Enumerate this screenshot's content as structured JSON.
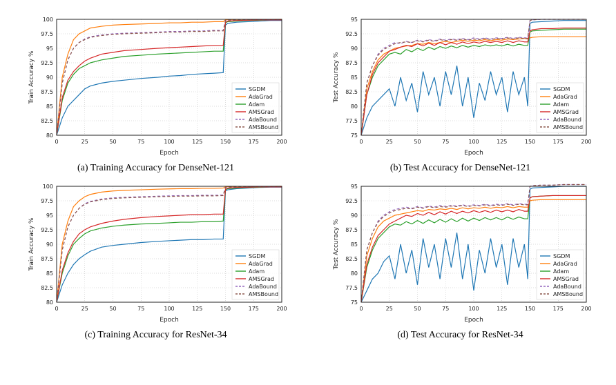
{
  "colors": {
    "SGDM": "#1f77b4",
    "AdaGrad": "#ff7f0e",
    "Adam": "#2ca02c",
    "AMSGrad": "#d62728",
    "AdaBound": "#9467bd",
    "AMSBound": "#8c564b"
  },
  "dashed": [
    "AdaBound",
    "AMSBound"
  ],
  "legend_order": [
    "SGDM",
    "AdaGrad",
    "Adam",
    "AMSGrad",
    "AdaBound",
    "AMSBound"
  ],
  "chart_data": [
    {
      "id": "a",
      "type": "line",
      "caption": "(a) Training Accuracy for DenseNet-121",
      "xlabel": "Epoch",
      "ylabel": "Train Accuracy %",
      "xlim": [
        0,
        200
      ],
      "ylim": [
        80.0,
        100.0
      ],
      "xticks": [
        0,
        25,
        50,
        75,
        100,
        125,
        150,
        175,
        200
      ],
      "yticks": [
        80.0,
        82.5,
        85.0,
        87.5,
        90.0,
        92.5,
        95.0,
        97.5,
        100.0
      ],
      "legend_pos": "lower-right",
      "x": [
        0,
        5,
        10,
        15,
        20,
        25,
        30,
        40,
        50,
        60,
        75,
        90,
        100,
        110,
        120,
        130,
        140,
        148,
        150,
        152,
        160,
        170,
        180,
        190,
        200
      ],
      "series": [
        {
          "name": "SGDM",
          "values": [
            80,
            83,
            85,
            86,
            87,
            88,
            88.5,
            89,
            89.3,
            89.5,
            89.8,
            90,
            90.2,
            90.3,
            90.5,
            90.6,
            90.7,
            90.8,
            99.0,
            99.3,
            99.5,
            99.6,
            99.7,
            99.8,
            99.8
          ]
        },
        {
          "name": "AdaGrad",
          "values": [
            80,
            90,
            94,
            96.5,
            97.5,
            98,
            98.5,
            98.8,
            99,
            99.1,
            99.2,
            99.3,
            99.4,
            99.4,
            99.5,
            99.5,
            99.6,
            99.6,
            99.9,
            99.95,
            99.97,
            99.98,
            99.99,
            99.99,
            100
          ]
        },
        {
          "name": "Adam",
          "values": [
            80,
            86,
            89,
            90.5,
            91.5,
            92,
            92.5,
            93,
            93.3,
            93.6,
            93.8,
            94,
            94.1,
            94.2,
            94.3,
            94.4,
            94.5,
            94.5,
            99.4,
            99.6,
            99.7,
            99.8,
            99.85,
            99.9,
            99.9
          ]
        },
        {
          "name": "AMSGrad",
          "values": [
            80,
            86.5,
            89.5,
            91,
            92,
            92.8,
            93.3,
            94,
            94.3,
            94.6,
            94.8,
            95,
            95.1,
            95.2,
            95.3,
            95.4,
            95.5,
            95.5,
            99.5,
            99.7,
            99.8,
            99.85,
            99.9,
            99.9,
            99.9
          ]
        },
        {
          "name": "AdaBound",
          "values": [
            80,
            89,
            93,
            95,
            96,
            96.6,
            97,
            97.3,
            97.5,
            97.6,
            97.7,
            97.8,
            97.9,
            97.9,
            98,
            98,
            98.1,
            98.1,
            99.8,
            99.9,
            99.93,
            99.95,
            99.97,
            99.98,
            99.98
          ]
        },
        {
          "name": "AMSBound",
          "values": [
            80,
            89,
            93,
            95,
            96,
            96.5,
            96.9,
            97.2,
            97.4,
            97.5,
            97.6,
            97.7,
            97.8,
            97.8,
            97.9,
            97.9,
            98,
            98,
            99.8,
            99.88,
            99.92,
            99.95,
            99.96,
            99.98,
            99.98
          ]
        }
      ]
    },
    {
      "id": "b",
      "type": "line",
      "caption": "(b) Test Accuracy for DenseNet-121",
      "xlabel": "Epoch",
      "ylabel": "Test Accuracy %",
      "xlim": [
        0,
        200
      ],
      "ylim": [
        75.0,
        95.0
      ],
      "xticks": [
        0,
        25,
        50,
        75,
        100,
        125,
        150,
        175,
        200
      ],
      "yticks": [
        75.0,
        77.5,
        80.0,
        82.5,
        85.0,
        87.5,
        90.0,
        92.5,
        95.0
      ],
      "legend_pos": "lower-right",
      "x": [
        0,
        5,
        10,
        15,
        20,
        25,
        30,
        35,
        40,
        45,
        50,
        55,
        60,
        65,
        70,
        75,
        80,
        85,
        90,
        95,
        100,
        105,
        110,
        115,
        120,
        125,
        130,
        135,
        140,
        145,
        148,
        150,
        152,
        160,
        170,
        180,
        190,
        200
      ],
      "series": [
        {
          "name": "SGDM",
          "values": [
            75,
            78,
            80,
            81,
            82,
            83,
            80,
            85,
            81,
            84,
            79,
            86,
            82,
            85,
            80,
            86,
            82,
            87,
            80,
            85,
            78,
            84,
            81,
            86,
            82,
            85,
            79,
            86,
            82,
            85,
            80,
            94.3,
            94.5,
            94.6,
            94.7,
            94.8,
            94.8,
            94.8
          ]
        },
        {
          "name": "AdaGrad",
          "values": [
            75,
            83,
            86,
            88,
            89,
            89.5,
            90,
            90.2,
            90.4,
            90.5,
            90.8,
            90.7,
            91,
            90.8,
            91,
            91.2,
            91,
            91.2,
            91.4,
            91.2,
            91.4,
            91.3,
            91.5,
            91.3,
            91.5,
            91.4,
            91.6,
            91.5,
            91.6,
            91.7,
            91.6,
            91.8,
            91.9,
            92,
            92,
            92,
            92,
            92
          ]
        },
        {
          "name": "Adam",
          "values": [
            75,
            82,
            85,
            87,
            88,
            89,
            89.3,
            89,
            89.8,
            89.4,
            90,
            89.6,
            90.2,
            89.8,
            90.3,
            90,
            90.4,
            90.1,
            90.5,
            90.2,
            90.5,
            90.3,
            90.6,
            90.4,
            90.6,
            90.4,
            90.7,
            90.4,
            90.7,
            90.5,
            90.5,
            92.8,
            93,
            93.1,
            93.2,
            93.3,
            93.3,
            93.3
          ]
        },
        {
          "name": "AMSGrad",
          "values": [
            75,
            82,
            85.5,
            87.5,
            88.5,
            89.5,
            89.8,
            90.2,
            90.5,
            90.3,
            90.8,
            90.4,
            90.9,
            90.5,
            91,
            90.6,
            91,
            90.7,
            91.1,
            90.8,
            91.1,
            90.9,
            91.2,
            91,
            91.2,
            91,
            91.3,
            91,
            91.3,
            91.1,
            91.1,
            93,
            93.2,
            93.4,
            93.4,
            93.5,
            93.5,
            93.5
          ]
        },
        {
          "name": "AdaBound",
          "values": [
            75,
            84,
            87,
            89,
            90,
            90.5,
            91,
            90.8,
            91.2,
            91,
            91.4,
            91.2,
            91.5,
            91.3,
            91.6,
            91.4,
            91.6,
            91.5,
            91.7,
            91.5,
            91.8,
            91.6,
            91.8,
            91.6,
            91.8,
            91.7,
            91.9,
            91.7,
            91.9,
            91.8,
            91.8,
            94.8,
            94.9,
            95,
            95,
            95,
            95,
            95
          ]
        },
        {
          "name": "AMSBound",
          "values": [
            75,
            84,
            87,
            88.8,
            89.8,
            90.3,
            90.8,
            91,
            91.1,
            91,
            91.3,
            91.1,
            91.4,
            91.2,
            91.5,
            91.3,
            91.5,
            91.4,
            91.6,
            91.4,
            91.6,
            91.5,
            91.7,
            91.5,
            91.7,
            91.6,
            91.8,
            91.6,
            91.8,
            91.7,
            91.7,
            94.8,
            94.9,
            95,
            95,
            95,
            95,
            95
          ]
        }
      ]
    },
    {
      "id": "c",
      "type": "line",
      "caption": "(c) Training Accuracy for ResNet-34",
      "xlabel": "Epoch",
      "ylabel": "Train Accuracy %",
      "xlim": [
        0,
        200
      ],
      "ylim": [
        80.0,
        100.0
      ],
      "xticks": [
        0,
        25,
        50,
        75,
        100,
        125,
        150,
        175,
        200
      ],
      "yticks": [
        80.0,
        82.5,
        85.0,
        87.5,
        90.0,
        92.5,
        95.0,
        97.5,
        100.0
      ],
      "legend_pos": "lower-right",
      "x": [
        0,
        5,
        10,
        15,
        20,
        25,
        30,
        40,
        50,
        60,
        75,
        90,
        100,
        110,
        120,
        130,
        140,
        148,
        150,
        152,
        160,
        170,
        180,
        190,
        200
      ],
      "series": [
        {
          "name": "SGDM",
          "values": [
            80,
            83,
            85,
            86.5,
            87.5,
            88.2,
            88.8,
            89.5,
            89.8,
            90,
            90.3,
            90.5,
            90.6,
            90.7,
            90.8,
            90.8,
            90.9,
            90.9,
            99.2,
            99.4,
            99.6,
            99.7,
            99.8,
            99.85,
            99.85
          ]
        },
        {
          "name": "AdaGrad",
          "values": [
            80,
            90,
            94,
            96.5,
            97.5,
            98.2,
            98.6,
            99,
            99.2,
            99.3,
            99.4,
            99.5,
            99.55,
            99.6,
            99.6,
            99.65,
            99.65,
            99.7,
            99.9,
            99.95,
            99.97,
            99.98,
            99.99,
            99.99,
            100
          ]
        },
        {
          "name": "Adam",
          "values": [
            80,
            85,
            88,
            90,
            91,
            91.8,
            92.3,
            92.8,
            93.1,
            93.3,
            93.5,
            93.6,
            93.7,
            93.8,
            93.8,
            93.9,
            93.9,
            94,
            99.4,
            99.6,
            99.7,
            99.8,
            99.85,
            99.9,
            99.9
          ]
        },
        {
          "name": "AMSGrad",
          "values": [
            80,
            85.5,
            88.5,
            90.5,
            91.8,
            92.5,
            93,
            93.6,
            94,
            94.3,
            94.6,
            94.8,
            94.9,
            95,
            95.1,
            95.1,
            95.2,
            95.2,
            99.5,
            99.7,
            99.8,
            99.85,
            99.9,
            99.9,
            99.9
          ]
        },
        {
          "name": "AdaBound",
          "values": [
            80,
            89,
            93,
            95,
            96.2,
            97,
            97.4,
            97.8,
            98,
            98.1,
            98.2,
            98.3,
            98.35,
            98.4,
            98.4,
            98.45,
            98.45,
            98.5,
            99.8,
            99.9,
            99.93,
            99.95,
            99.97,
            99.98,
            99.98
          ]
        },
        {
          "name": "AMSBound",
          "values": [
            80,
            89,
            93,
            95,
            96.2,
            96.9,
            97.3,
            97.7,
            97.9,
            98,
            98.1,
            98.2,
            98.25,
            98.3,
            98.3,
            98.35,
            98.35,
            98.4,
            99.8,
            99.88,
            99.92,
            99.95,
            99.96,
            99.98,
            99.98
          ]
        }
      ]
    },
    {
      "id": "d",
      "type": "line",
      "caption": "(d) Test Accuracy for ResNet-34",
      "xlabel": "Epoch",
      "ylabel": "Test Accuracy %",
      "xlim": [
        0,
        200
      ],
      "ylim": [
        75.0,
        95.0
      ],
      "xticks": [
        0,
        25,
        50,
        75,
        100,
        125,
        150,
        175,
        200
      ],
      "yticks": [
        75.0,
        77.5,
        80.0,
        82.5,
        85.0,
        87.5,
        90.0,
        92.5,
        95.0
      ],
      "legend_pos": "lower-right",
      "x": [
        0,
        5,
        10,
        15,
        20,
        25,
        30,
        35,
        40,
        45,
        50,
        55,
        60,
        65,
        70,
        75,
        80,
        85,
        90,
        95,
        100,
        105,
        110,
        115,
        120,
        125,
        130,
        135,
        140,
        145,
        148,
        150,
        152,
        160,
        170,
        180,
        190,
        200
      ],
      "series": [
        {
          "name": "SGDM",
          "values": [
            75,
            77,
            79,
            80,
            82,
            83,
            79,
            85,
            80,
            84,
            78,
            86,
            81,
            85,
            79,
            86,
            81,
            87,
            79,
            85,
            77,
            84,
            80,
            86,
            81,
            85,
            78,
            86,
            81,
            85,
            79,
            94.5,
            94.7,
            94.8,
            94.9,
            95,
            95,
            95
          ]
        },
        {
          "name": "AdaGrad",
          "values": [
            75,
            83,
            86,
            88,
            89,
            89.5,
            90,
            90.2,
            90.4,
            90.6,
            90.8,
            90.7,
            91,
            90.9,
            91.1,
            91,
            91.2,
            91,
            91.3,
            91.1,
            91.3,
            91.2,
            91.4,
            91.2,
            91.4,
            91.3,
            91.5,
            91.3,
            91.5,
            91.4,
            91.4,
            92.5,
            92.6,
            92.7,
            92.7,
            92.7,
            92.7,
            92.7
          ]
        },
        {
          "name": "Adam",
          "values": [
            75,
            81,
            84,
            86,
            87,
            88,
            88.5,
            88.3,
            88.9,
            88.5,
            89.1,
            88.6,
            89.2,
            88.7,
            89.3,
            88.8,
            89.4,
            88.9,
            89.5,
            89,
            89.5,
            89.1,
            89.6,
            89.2,
            89.6,
            89.2,
            89.7,
            89.3,
            89.7,
            89.4,
            89.4,
            93,
            93.2,
            93.3,
            93.4,
            93.4,
            93.4,
            93.4
          ]
        },
        {
          "name": "AMSGrad",
          "values": [
            75,
            81.5,
            84.5,
            86.5,
            87.5,
            88.5,
            89,
            89.5,
            90,
            89.8,
            90.3,
            90,
            90.5,
            90.1,
            90.6,
            90.2,
            90.7,
            90.3,
            90.7,
            90.4,
            90.8,
            90.5,
            90.8,
            90.5,
            90.9,
            90.6,
            90.9,
            90.6,
            91,
            90.7,
            90.7,
            93,
            93.2,
            93.3,
            93.4,
            93.4,
            93.4,
            93.4
          ]
        },
        {
          "name": "AdaBound",
          "values": [
            75,
            84,
            87,
            89,
            90,
            90.6,
            91,
            91.2,
            91.4,
            91.2,
            91.5,
            91.3,
            91.6,
            91.4,
            91.7,
            91.5,
            91.7,
            91.6,
            91.8,
            91.6,
            91.8,
            91.7,
            91.9,
            91.7,
            91.9,
            91.8,
            92,
            91.8,
            92,
            91.9,
            91.9,
            95,
            95.1,
            95.2,
            95.2,
            95.3,
            95.3,
            95.3
          ]
        },
        {
          "name": "AMSBound",
          "values": [
            75,
            84,
            87,
            88.8,
            89.8,
            90.4,
            90.8,
            91,
            91.2,
            91.1,
            91.4,
            91.2,
            91.5,
            91.3,
            91.5,
            91.4,
            91.6,
            91.5,
            91.7,
            91.5,
            91.7,
            91.6,
            91.8,
            91.6,
            91.8,
            91.7,
            91.9,
            91.7,
            91.9,
            91.8,
            91.8,
            95,
            95.1,
            95.2,
            95.2,
            95.3,
            95.3,
            95.3
          ]
        }
      ]
    }
  ]
}
